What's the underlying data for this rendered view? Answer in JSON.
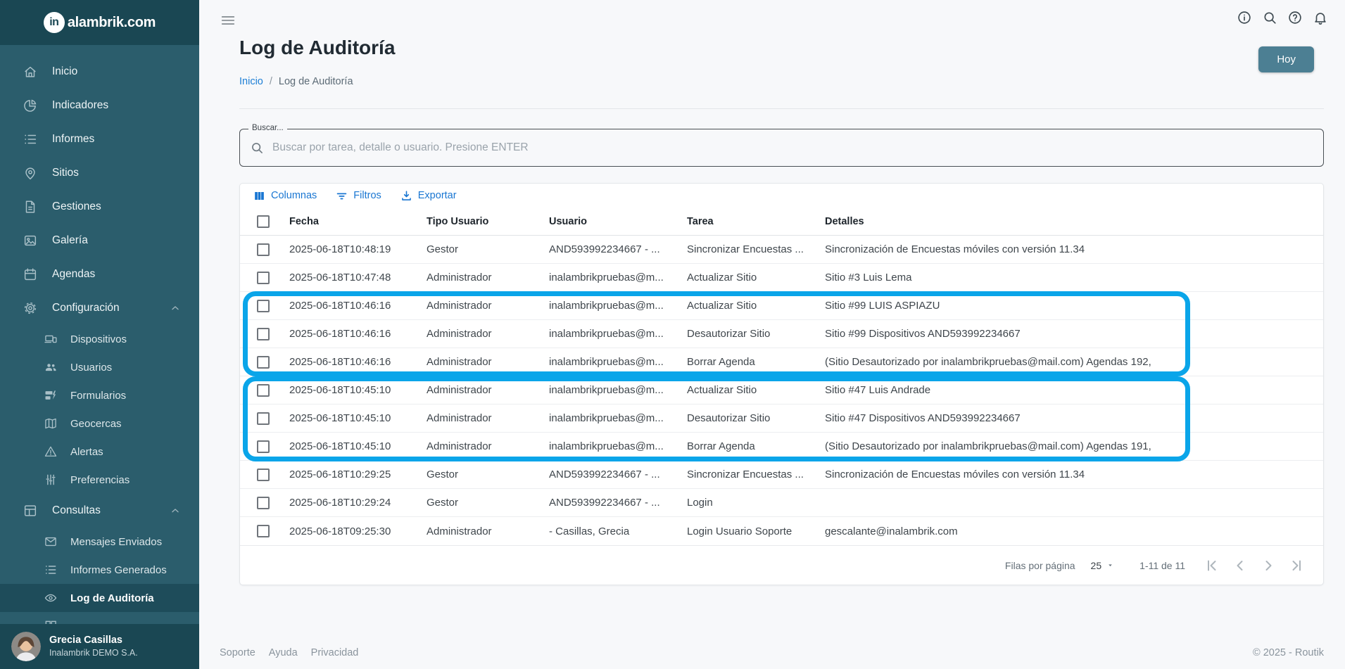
{
  "brand": {
    "logo_mark": "in",
    "logo_text": "alambrik.com"
  },
  "sidebar": {
    "inicio": "Inicio",
    "indicadores": "Indicadores",
    "informes": "Informes",
    "sitios": "Sitios",
    "gestiones": "Gestiones",
    "galeria": "Galería",
    "agendas": "Agendas",
    "configuracion": "Configuración",
    "dispositivos": "Dispositivos",
    "usuarios": "Usuarios",
    "formularios": "Formularios",
    "geocercas": "Geocercas",
    "alertas": "Alertas",
    "preferencias": "Preferencias",
    "consultas": "Consultas",
    "mensajes_enviados": "Mensajes Enviados",
    "informes_generados": "Informes Generados",
    "log_auditoria": "Log de Auditoría",
    "user": {
      "name": "Grecia Casillas",
      "org": "Inalambrik DEMO S.A."
    }
  },
  "page": {
    "title": "Log de Auditoría",
    "breadcrumb_home": "Inicio",
    "breadcrumb_sep": "/",
    "breadcrumb_current": "Log de Auditoría",
    "today_button": "Hoy"
  },
  "search": {
    "label": "Buscar...",
    "placeholder": "Buscar por tarea, detalle o usuario. Presione ENTER"
  },
  "toolbar": {
    "columnas": "Columnas",
    "filtros": "Filtros",
    "exportar": "Exportar"
  },
  "table": {
    "headers": {
      "fecha": "Fecha",
      "tipo": "Tipo Usuario",
      "usuario": "Usuario",
      "tarea": "Tarea",
      "detalles": "Detalles"
    },
    "rows": [
      {
        "fecha": "2025-06-18T10:48:19",
        "tipo": "Gestor",
        "usuario": "AND593992234667 - ...",
        "tarea": "Sincronizar Encuestas ...",
        "detalles": "Sincronización de Encuestas móviles con versión 11.34"
      },
      {
        "fecha": "2025-06-18T10:47:48",
        "tipo": "Administrador",
        "usuario": "inalambrikpruebas@m...",
        "tarea": "Actualizar Sitio",
        "detalles": "Sitio #3 Luis Lema"
      },
      {
        "fecha": "2025-06-18T10:46:16",
        "tipo": "Administrador",
        "usuario": "inalambrikpruebas@m...",
        "tarea": "Actualizar Sitio",
        "detalles": "Sitio #99 LUIS ASPIAZU"
      },
      {
        "fecha": "2025-06-18T10:46:16",
        "tipo": "Administrador",
        "usuario": "inalambrikpruebas@m...",
        "tarea": "Desautorizar Sitio",
        "detalles": "Sitio #99 Dispositivos AND593992234667"
      },
      {
        "fecha": "2025-06-18T10:46:16",
        "tipo": "Administrador",
        "usuario": "inalambrikpruebas@m...",
        "tarea": "Borrar Agenda",
        "detalles": "(Sitio Desautorizado por inalambrikpruebas@mail.com) Agendas 192,"
      },
      {
        "fecha": "2025-06-18T10:45:10",
        "tipo": "Administrador",
        "usuario": "inalambrikpruebas@m...",
        "tarea": "Actualizar Sitio",
        "detalles": "Sitio #47 Luis Andrade"
      },
      {
        "fecha": "2025-06-18T10:45:10",
        "tipo": "Administrador",
        "usuario": "inalambrikpruebas@m...",
        "tarea": "Desautorizar Sitio",
        "detalles": "Sitio #47 Dispositivos AND593992234667"
      },
      {
        "fecha": "2025-06-18T10:45:10",
        "tipo": "Administrador",
        "usuario": "inalambrikpruebas@m...",
        "tarea": "Borrar Agenda",
        "detalles": "(Sitio Desautorizado por inalambrikpruebas@mail.com) Agendas 191,"
      },
      {
        "fecha": "2025-06-18T10:29:25",
        "tipo": "Gestor",
        "usuario": "AND593992234667 - ...",
        "tarea": "Sincronizar Encuestas ...",
        "detalles": "Sincronización de Encuestas móviles con versión 11.34"
      },
      {
        "fecha": "2025-06-18T10:29:24",
        "tipo": "Gestor",
        "usuario": "AND593992234667 - ...",
        "tarea": "Login",
        "detalles": ""
      },
      {
        "fecha": "2025-06-18T09:25:30",
        "tipo": "Administrador",
        "usuario": "- Casillas, Grecia",
        "tarea": "Login Usuario Soporte",
        "detalles": "gescalante@inalambrik.com"
      }
    ]
  },
  "pagination": {
    "label": "Filas por página",
    "per_page": "25",
    "range": "1-11 de 11"
  },
  "footer": {
    "links": [
      "Soporte",
      "Ayuda",
      "Privacidad"
    ],
    "copyright": "© 2025 - Routik"
  },
  "colors": {
    "accent_blue": "#1976d2",
    "annotation_blue": "#0aa5e9",
    "sidebar_teal": "#2b5d6c",
    "button_teal": "#4c7f93"
  }
}
